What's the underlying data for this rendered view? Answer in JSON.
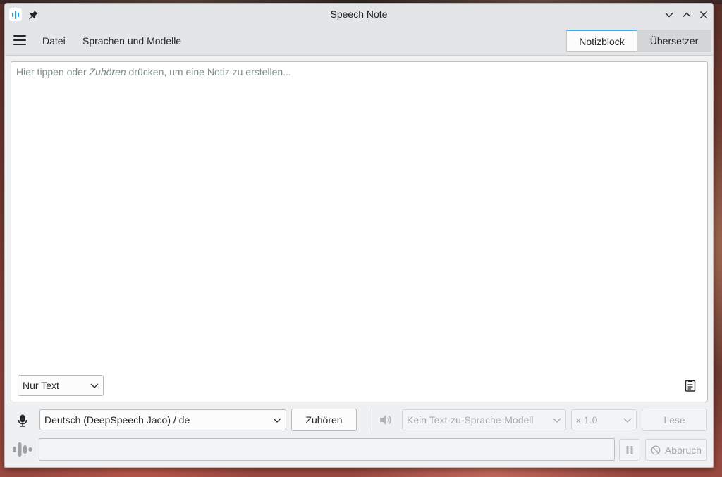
{
  "window": {
    "title": "Speech Note"
  },
  "menu": {
    "file": "Datei",
    "languages_models": "Sprachen und Modelle"
  },
  "tabs": [
    {
      "label": "Notizblock",
      "active": true
    },
    {
      "label": "Übersetzer",
      "active": false
    }
  ],
  "editor": {
    "placeholder_before": "Hier tippen oder ",
    "placeholder_em": "Zuhören",
    "placeholder_after": " drücken, um eine Notiz zu erstellen..."
  },
  "text_format": {
    "selected": "Nur Text"
  },
  "stt": {
    "model_selected": "Deutsch (DeepSpeech Jaco) / de",
    "listen_label": "Zuhören"
  },
  "tts": {
    "model_selected": "Kein Text-zu-Sprache-Modell",
    "speed_selected": "x 1.0",
    "read_label": "Lese"
  },
  "controls": {
    "cancel_label": "Abbruch"
  },
  "colors": {
    "accent": "#3daee9",
    "app_icon": "#1d99f3"
  }
}
